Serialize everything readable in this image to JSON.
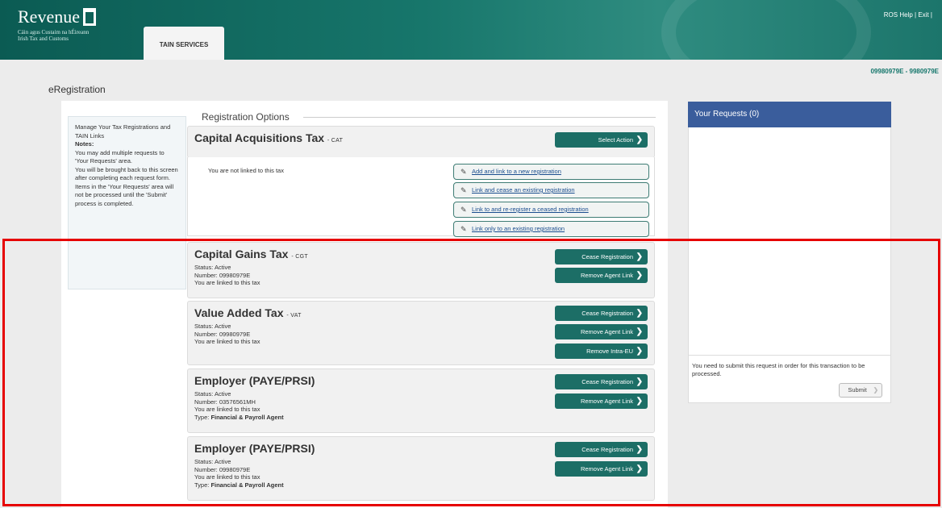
{
  "header": {
    "logo_text": "Revenue",
    "logo_sub1": "Cáin agus Custaim na hÉireann",
    "logo_sub2": "Irish Tax and Customs",
    "tab_label": "TAIN SERVICES",
    "help_link": "ROS Help",
    "sep": "|",
    "exit_link": "Exit",
    "sep2": "|"
  },
  "account_ids": "09980979E - 9980979E",
  "page_title": "eRegistration",
  "sidebar": {
    "intro": "Manage Your Tax Registrations and TAIN Links",
    "notes_heading": "Notes:",
    "note1": "You may add multiple requests to 'Your Requests' area.",
    "note2": "You will be brought back to this screen after completing each request form.",
    "note3": "Items in the 'Your Requests' area will not be processed until the 'Submit' process is completed."
  },
  "registration_options_label": "Registration Options",
  "cat": {
    "title": "Capital Acquisitions Tax",
    "code": "- CAT",
    "select_action": "Select Action",
    "not_linked": "You are not linked to this tax",
    "links": [
      "Add and link to a new registration",
      "Link and cease an existing registration",
      "Link to and re-register a ceased registration",
      "Link only to an existing registration"
    ]
  },
  "taxes": [
    {
      "title": "Capital Gains Tax",
      "code": "- CGT",
      "status": "Status: Active",
      "number": "Number: 09980979E",
      "linked": "You are linked to this tax",
      "type": "",
      "buttons": [
        "Cease Registration",
        "Remove Agent Link"
      ]
    },
    {
      "title": "Value Added Tax",
      "code": "- VAT",
      "status": "Status: Active",
      "number": "Number: 09980979E",
      "linked": "You are linked to this tax",
      "type": "",
      "buttons": [
        "Cease Registration",
        "Remove Agent Link",
        "Remove Intra-EU"
      ]
    },
    {
      "title": "Employer (PAYE/PRSI)",
      "code": "",
      "status": "Status: Active",
      "number": "Number: 03576561MH",
      "linked": "You are linked to this tax",
      "type_label": "Type:",
      "type": "Financial & Payroll Agent",
      "buttons": [
        "Cease Registration",
        "Remove Agent Link"
      ]
    },
    {
      "title": "Employer (PAYE/PRSI)",
      "code": "",
      "status": "Status: Active",
      "number": "Number: 09980979E",
      "linked": "You are linked to this tax",
      "type_label": "Type:",
      "type": "Financial & Payroll Agent",
      "buttons": [
        "Cease Registration",
        "Remove Agent Link"
      ]
    }
  ],
  "requests": {
    "heading": "Your Requests (0)",
    "message": "You need to submit this request in order for this transaction to be processed.",
    "submit_label": "Submit"
  },
  "icons": {
    "chevron": "chevron-right-icon",
    "pencil": "pencil-icon"
  }
}
